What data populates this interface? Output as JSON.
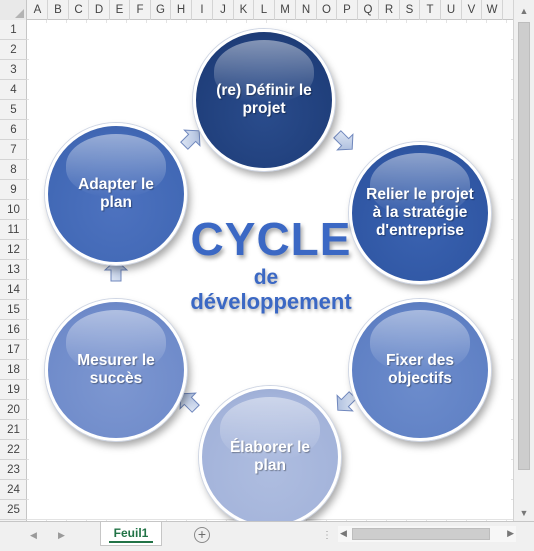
{
  "sheet": {
    "columns": [
      "A",
      "B",
      "C",
      "D",
      "E",
      "F",
      "G",
      "H",
      "I",
      "J",
      "K",
      "L",
      "M",
      "N",
      "O",
      "P",
      "Q",
      "R",
      "S",
      "T",
      "U",
      "V",
      "W"
    ],
    "rows": [
      "1",
      "2",
      "3",
      "4",
      "5",
      "6",
      "7",
      "8",
      "9",
      "10",
      "11",
      "12",
      "13",
      "14",
      "15",
      "16",
      "17",
      "18",
      "19",
      "20",
      "21",
      "22",
      "23",
      "24",
      "25"
    ],
    "tab_label": "Feuil1",
    "add_sheet_symbol": "+"
  },
  "diagram": {
    "title_main": "CYCLE",
    "title_connector": "de",
    "title_sub": "développement",
    "steps": [
      {
        "label": "(re) Définir le projet",
        "color": "#1f3e7a"
      },
      {
        "label": "Relier le projet à la stratégie d'entreprise",
        "color": "#2f56a3"
      },
      {
        "label": "Fixer des objectifs",
        "color": "#5f80c4"
      },
      {
        "label": "Élaborer le plan",
        "color": "#a3b3da"
      },
      {
        "label": "Mesurer le succès",
        "color": "#6f8bca"
      },
      {
        "label": "Adapter le plan",
        "color": "#4168b5"
      }
    ]
  },
  "colors": {
    "accent_green": "#217346",
    "title_blue": "#3b68c4"
  }
}
